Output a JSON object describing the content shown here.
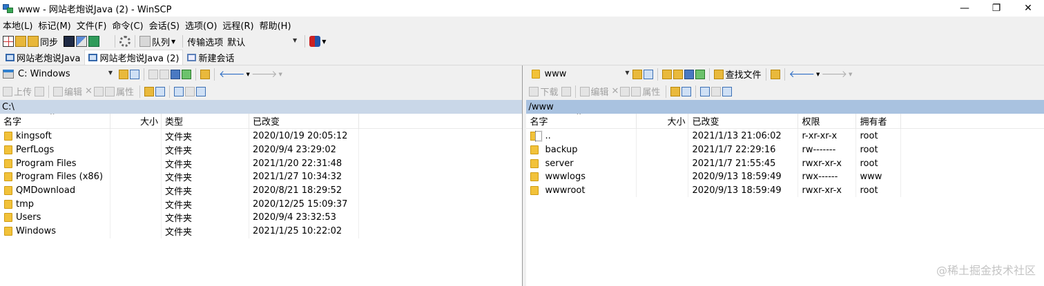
{
  "window": {
    "title": "www - 网站老炮说Java (2) - WinSCP",
    "minimize": "—",
    "restore": "❐",
    "close": "✕"
  },
  "menu": [
    "本地(L)",
    "标记(M)",
    "文件(F)",
    "命令(C)",
    "会话(S)",
    "选项(O)",
    "远程(R)",
    "帮助(H)"
  ],
  "toolbar": {
    "sync_label": "同步",
    "queue_label": "队列",
    "transfer_options_label": "传输选项",
    "transfer_preset": "默认"
  },
  "tabs": [
    {
      "label": "网站老炮说Java",
      "active": false
    },
    {
      "label": "网站老炮说Java (2)",
      "active": true
    },
    {
      "label": "新建会话",
      "active": false
    }
  ],
  "left": {
    "drive": "C: Windows",
    "upload_label": "上传",
    "edit_label": "编辑",
    "props_label": "属性",
    "path": "C:\\",
    "columns": {
      "name": "名字",
      "size": "大小",
      "type": "类型",
      "changed": "已改变"
    },
    "files": [
      {
        "name": "kingsoft",
        "type": "文件夹",
        "changed": "2020/10/19  20:05:12"
      },
      {
        "name": "PerfLogs",
        "type": "文件夹",
        "changed": "2020/9/4  23:29:02"
      },
      {
        "name": "Program Files",
        "type": "文件夹",
        "changed": "2021/1/20  22:31:48"
      },
      {
        "name": "Program Files (x86)",
        "type": "文件夹",
        "changed": "2021/1/27  10:34:32"
      },
      {
        "name": "QMDownload",
        "type": "文件夹",
        "changed": "2020/8/21  18:29:52"
      },
      {
        "name": "tmp",
        "type": "文件夹",
        "changed": "2020/12/25  15:09:37"
      },
      {
        "name": "Users",
        "type": "文件夹",
        "changed": "2020/9/4  23:32:53"
      },
      {
        "name": "Windows",
        "type": "文件夹",
        "changed": "2021/1/25  10:22:02"
      }
    ]
  },
  "right": {
    "dir": "www",
    "find_label": "查找文件",
    "download_label": "下载",
    "edit_label": "编辑",
    "props_label": "属性",
    "path": "/www",
    "columns": {
      "name": "名字",
      "size": "大小",
      "changed": "已改变",
      "rights": "权限",
      "owner": "拥有者"
    },
    "files": [
      {
        "name": "..",
        "changed": "2021/1/13 21:06:02",
        "rights": "r-xr-xr-x",
        "owner": "root",
        "up": true
      },
      {
        "name": "backup",
        "changed": "2021/1/7 22:29:16",
        "rights": "rw-------",
        "owner": "root"
      },
      {
        "name": "server",
        "changed": "2021/1/7 21:55:45",
        "rights": "rwxr-xr-x",
        "owner": "root"
      },
      {
        "name": "wwwlogs",
        "changed": "2020/9/13 18:59:49",
        "rights": "rwx------",
        "owner": "www"
      },
      {
        "name": "wwwroot",
        "changed": "2020/9/13 18:59:49",
        "rights": "rwxr-xr-x",
        "owner": "root"
      }
    ]
  },
  "watermark": "@稀土掘金技术社区"
}
